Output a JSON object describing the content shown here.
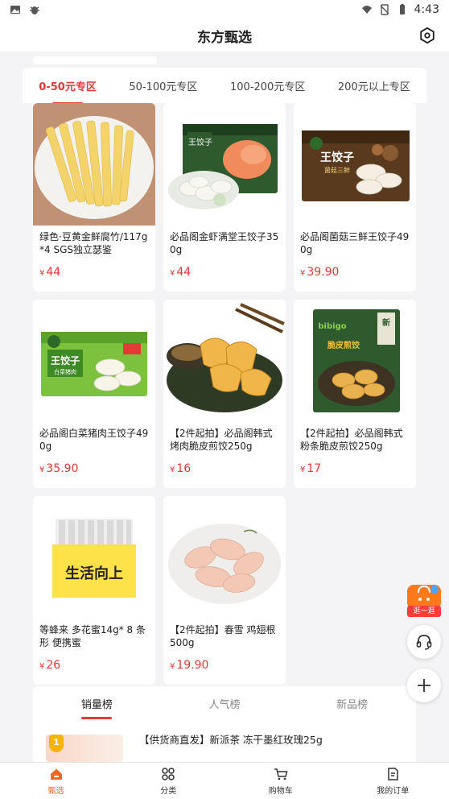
{
  "status_bar": {
    "time": "4:43"
  },
  "header": {
    "title": "东方甄选"
  },
  "zone_tabs": [
    {
      "label": "0-50元专区",
      "active": true
    },
    {
      "label": "50-100元专区",
      "active": false
    },
    {
      "label": "100-200元专区",
      "active": false
    },
    {
      "label": "200元以上专区",
      "active": false
    }
  ],
  "currency": "¥",
  "products": [
    {
      "name": "绿色·豆黄金鲜腐竹/117g*4 SGS独立瑟鉴",
      "price": "44"
    },
    {
      "name": "必品阁金虾满堂王饺子350g",
      "price": "44"
    },
    {
      "name": "必品阁菌菇三鲜王饺子490g",
      "price": "39.90"
    },
    {
      "name": "必品阁白菜猪肉王饺子490g",
      "price": "35.90"
    },
    {
      "name": "【2件起拍】必品阁韩式烤肉脆皮煎饺250g",
      "price": "16"
    },
    {
      "name": "【2件起拍】必品阁韩式粉条脆皮煎饺250g",
      "price": "17"
    },
    {
      "name": "等蜂来 多花蜜14g* 8 条形 便携蜜",
      "price": "26"
    },
    {
      "name": "【2件起拍】春雪 鸡翅根500g",
      "price": "19.90"
    }
  ],
  "product_images": {
    "p3_pack_title": "王饺子",
    "p3_pack_sub": "菌菇三鲜",
    "p4_pack_title": "王饺子",
    "p4_pack_sub": "白菜猪肉",
    "p2_pack_title": "王饺子",
    "p6_pack_brand": "bibigo",
    "p6_pack_tag": "新",
    "p6_pack_title": "脆皮煎饺",
    "p7_pack_title": "生活向上"
  },
  "ranking": {
    "tabs": [
      {
        "label": "销量榜",
        "active": true
      },
      {
        "label": "人气榜",
        "active": false
      },
      {
        "label": "新品榜",
        "active": false
      }
    ],
    "first_item": {
      "rank": "1",
      "name": "【供货商直发】新派茶 冻干墨红玫瑰25g"
    }
  },
  "floating": {
    "stroll_label": "逛一逛"
  },
  "bottom_nav": [
    {
      "label": "甄选",
      "icon": "home-icon",
      "active": true
    },
    {
      "label": "分类",
      "icon": "category-icon",
      "active": false
    },
    {
      "label": "购物车",
      "icon": "cart-icon",
      "active": false
    },
    {
      "label": "我的订单",
      "icon": "order-icon",
      "active": false
    }
  ],
  "colors": {
    "accent": "#e53935",
    "nav_active": "#f26a1b",
    "stroll": "#ff7a1a"
  }
}
